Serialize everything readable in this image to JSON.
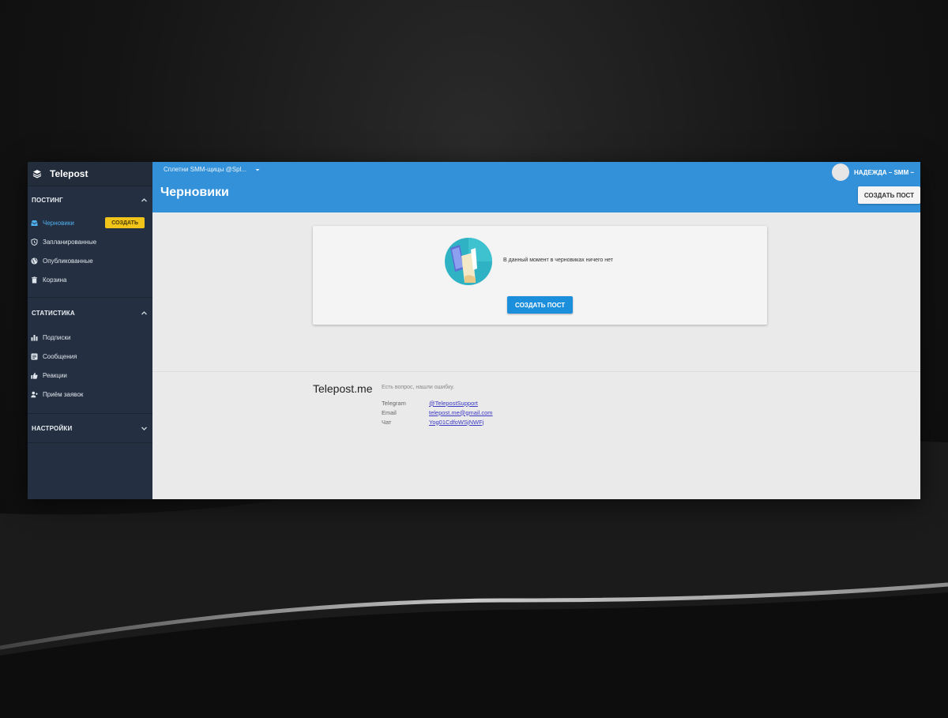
{
  "app": {
    "name": "Telepost"
  },
  "sidebar": {
    "sections": [
      {
        "title": "ПОСТИНГ",
        "items": [
          {
            "label": "Черновики",
            "icon": "inbox-icon",
            "active": true,
            "badge": "СОЗДАТЬ"
          },
          {
            "label": "Запланированные",
            "icon": "clock-shield-icon"
          },
          {
            "label": "Опубликованные",
            "icon": "globe-icon"
          },
          {
            "label": "Корзина",
            "icon": "trash-icon"
          }
        ]
      },
      {
        "title": "СТАТИСТИКА",
        "items": [
          {
            "label": "Подписки",
            "icon": "bar-chart-icon"
          },
          {
            "label": "Сообщения",
            "icon": "message-icon"
          },
          {
            "label": "Реакции",
            "icon": "thumbs-up-icon"
          },
          {
            "label": "Приём заявок",
            "icon": "person-add-icon"
          }
        ]
      },
      {
        "title": "НАСТРОЙКИ",
        "items": []
      }
    ]
  },
  "header": {
    "project": "Сплетни SMM-щицы @Spl...",
    "title": "Черновики",
    "user": "НАДЕЖДА – SMM ~",
    "create_button": "СОЗДАТЬ ПОСТ"
  },
  "empty_state": {
    "message": "В данный момент в черновиках ничего нет",
    "button": "СОЗДАТЬ ПОСТ"
  },
  "footer": {
    "brand": "Telepost.me",
    "tagline": "Есть вопрос, нашли ошибку.",
    "contacts": [
      {
        "label": "Telegram",
        "value": "@TelepostSupport"
      },
      {
        "label": "Email",
        "value": "telepost.me@gmail.com"
      },
      {
        "label": "Чат",
        "value": "Yog01CdfoWSjNWFj"
      }
    ]
  },
  "colors": {
    "sidebar_bg": "#243041",
    "header_bg": "#3391d9",
    "accent": "#1c8fdc",
    "badge": "#f0c419"
  }
}
